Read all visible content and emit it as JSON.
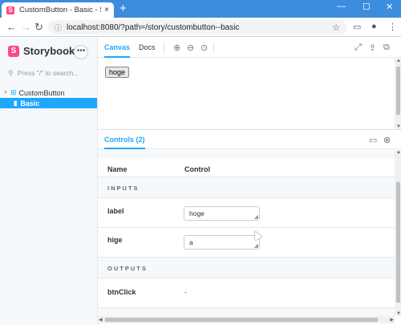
{
  "browser": {
    "tab_title": "CustomButton - Basic - Storybook",
    "tab_close": "×",
    "new_tab": "+",
    "url": "localhost:8080/?path=/story/custombutton--basic",
    "window_controls": [
      "—",
      "☐",
      "✕"
    ]
  },
  "sidebar": {
    "brand": "Storybook",
    "menu_label": "•••",
    "search_placeholder": "Press \"/\" to search...",
    "tree": {
      "component": "CustomButton",
      "story": "Basic"
    }
  },
  "main": {
    "tabs": [
      "Canvas",
      "Docs"
    ],
    "canvas_button_label": "hoge",
    "addons_tab": "Controls (2)",
    "controls": {
      "headers": {
        "name": "Name",
        "control": "Control"
      },
      "sections": [
        {
          "title": "INPUTS",
          "props": [
            {
              "name": "label",
              "value": "hoge"
            },
            {
              "name": "hige",
              "value": "a"
            }
          ]
        },
        {
          "title": "OUTPUTS",
          "props": [
            {
              "name": "btnClick",
              "value": "-"
            }
          ]
        }
      ]
    }
  },
  "colors": {
    "accent": "#1ea7fd",
    "brand": "#ff4785",
    "chrome": "#3c8dde"
  }
}
